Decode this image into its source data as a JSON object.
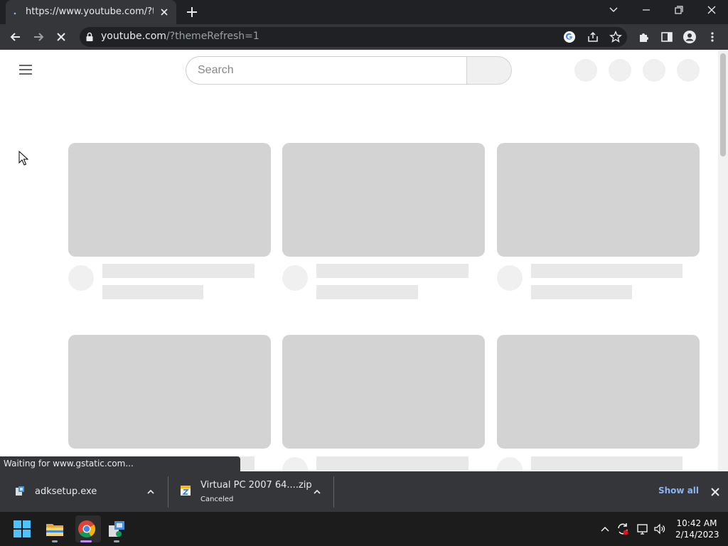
{
  "browser": {
    "tab_title": "https://www.youtube.com/?themeRefresh=1",
    "url_host": "youtube.com",
    "url_path": "/?themeRefresh=1",
    "status_text": "Waiting for www.gstatic.com..."
  },
  "page": {
    "search_placeholder": "Search"
  },
  "downloads": [
    {
      "name": "adksetup.exe",
      "status": ""
    },
    {
      "name": "Virtual PC 2007 64....zip",
      "status": "Canceled"
    }
  ],
  "downloads_show_all": "Show all",
  "taskbar": {
    "time": "10:42 AM",
    "date": "2/14/2023"
  },
  "icons": [
    "back-icon",
    "forward-icon",
    "stop-loading-icon",
    "lock-icon",
    "google-icon",
    "share-icon",
    "bookmark-star-icon",
    "extensions-icon",
    "side-panel-icon",
    "profile-icon",
    "menu-dots-icon",
    "hamburger-menu-icon",
    "windows-start-icon",
    "file-explorer-icon",
    "chrome-icon"
  ]
}
